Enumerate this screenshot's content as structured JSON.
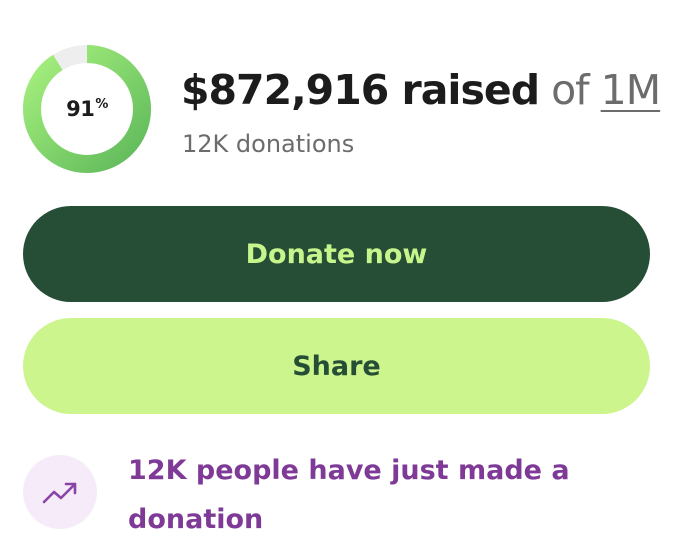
{
  "progress": {
    "percent_value": 0.91,
    "label_number": "91",
    "label_suffix": "%",
    "color_start": "#a7f17e",
    "color_end": "#5eb85a",
    "track_color": "#eeeeee"
  },
  "fundraiser": {
    "raised_amount": "$872,916 raised",
    "of_label": "of",
    "goal": "1M",
    "donations_count": "12K donations"
  },
  "actions": {
    "donate_label": "Donate now",
    "share_label": "Share"
  },
  "activity": {
    "icon": "trending-up-icon",
    "text": "12K people have just made a donation"
  },
  "colors": {
    "dark_green": "#264d36",
    "lime": "#cdf58e",
    "purple": "#7e3a96",
    "light_purple": "#f6ebf8"
  }
}
